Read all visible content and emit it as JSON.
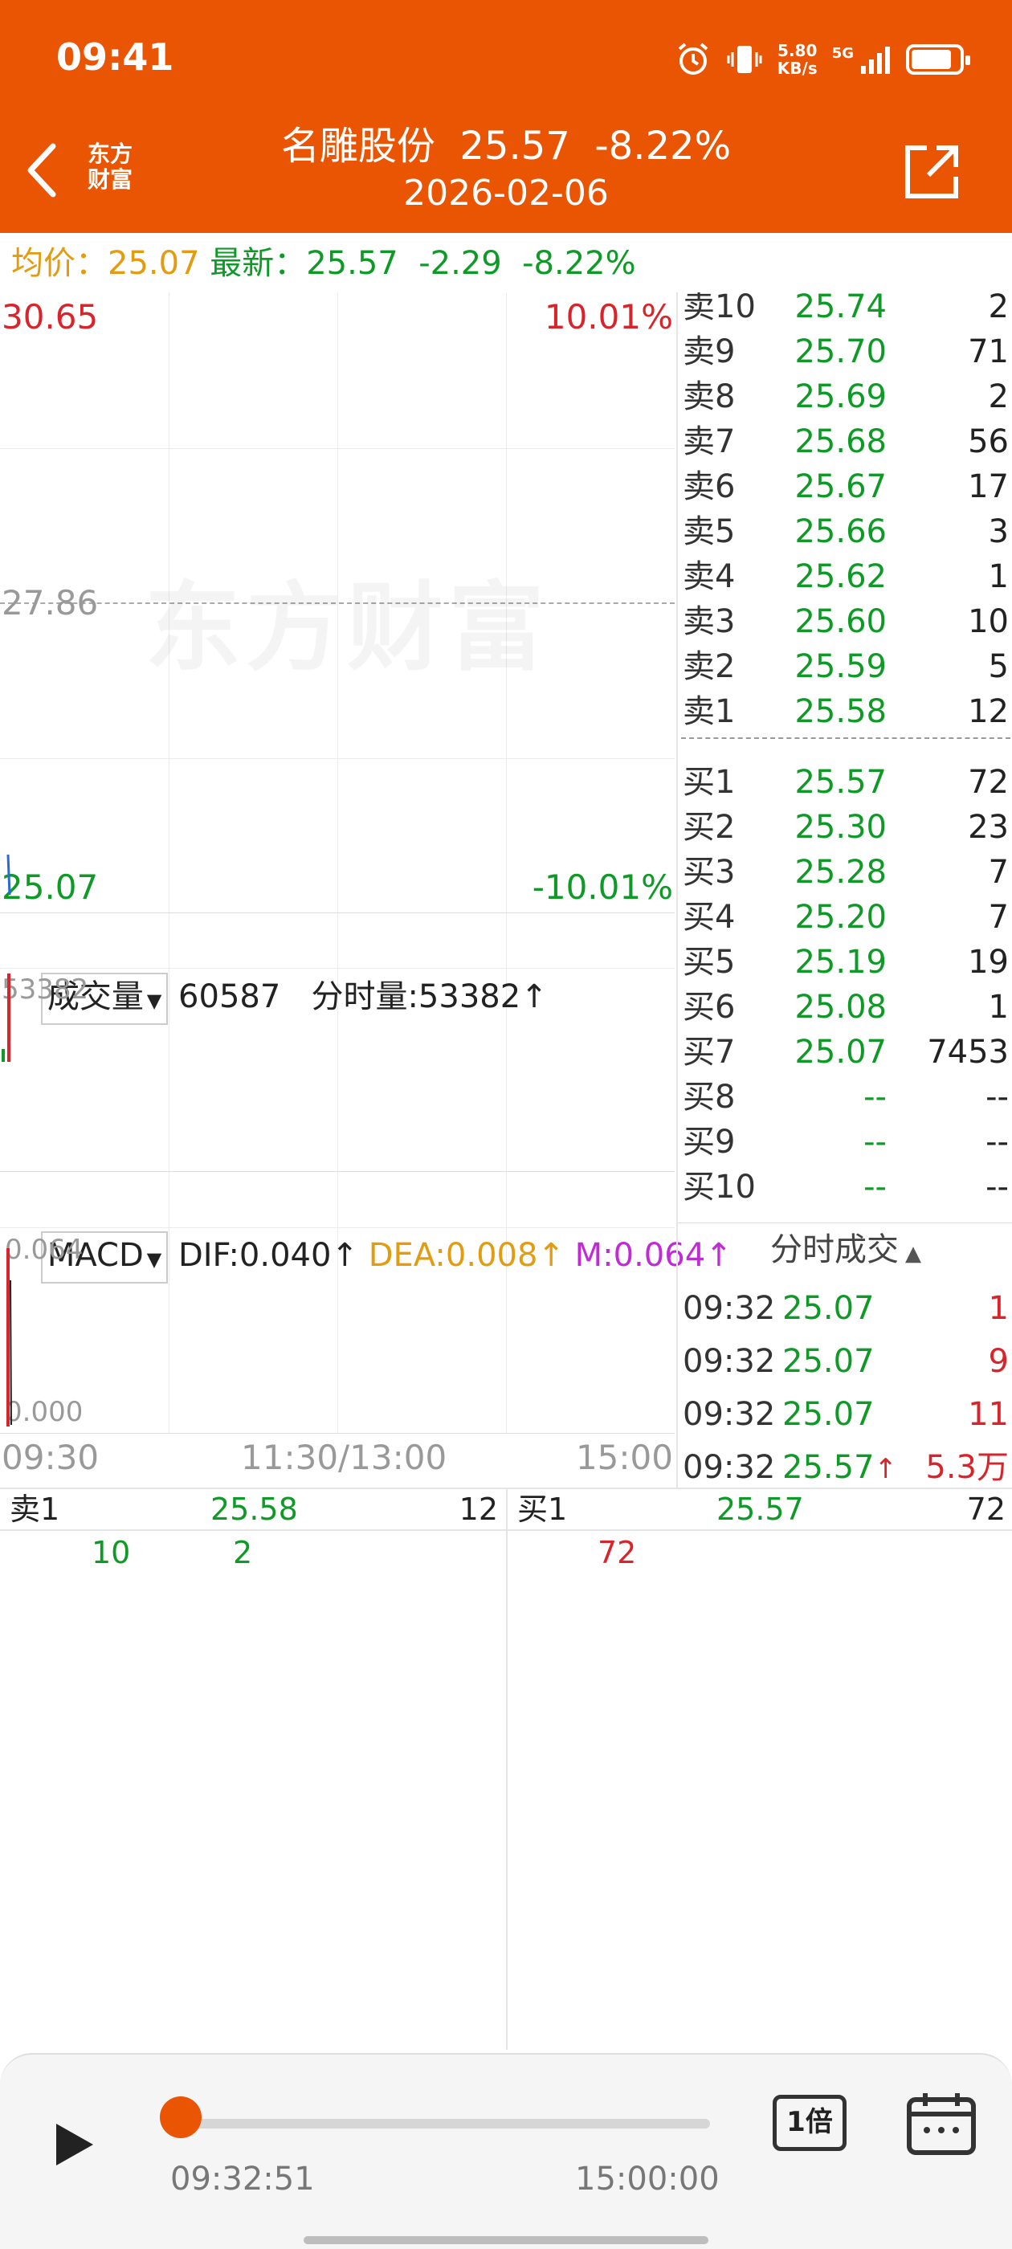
{
  "status_bar": {
    "time": "09:41",
    "net_speed_value": "5.80",
    "net_speed_unit": "KB/s",
    "network": "5G",
    "battery_level": 0.85
  },
  "header": {
    "logo_line1": "东方",
    "logo_line2": "财富",
    "stock_name": "名雕股份",
    "price": "25.57",
    "change_pct": "-8.22%",
    "date": "2026-02-06"
  },
  "info": {
    "avg_label": "均价：",
    "avg_value": "25.07",
    "latest_label": "最新：",
    "latest_value": "25.57",
    "change": "-2.29",
    "change_pct": "-8.22%"
  },
  "price_chart": {
    "high": "30.65",
    "high_pct": "10.01%",
    "mid": "27.86",
    "low": "25.07",
    "low_pct": "-10.01%",
    "watermark": "东方财富"
  },
  "volume_panel": {
    "selector": "成交量",
    "total": "60587",
    "minute_label": "分时量:53382",
    "axis_max": "53382"
  },
  "macd_panel": {
    "selector": "MACD",
    "dif": "DIF:0.040",
    "dea": "DEA:0.008",
    "m": "M:0.064",
    "axis_top": "0.064",
    "axis_bottom": "0.000"
  },
  "time_axis": {
    "start": "09:30",
    "middle": "11:30/13:00",
    "end": "15:00"
  },
  "order_book": {
    "asks": [
      {
        "name": "卖10",
        "price": "25.74",
        "vol": "2"
      },
      {
        "name": "卖9",
        "price": "25.70",
        "vol": "71"
      },
      {
        "name": "卖8",
        "price": "25.69",
        "vol": "2"
      },
      {
        "name": "卖7",
        "price": "25.68",
        "vol": "56"
      },
      {
        "name": "卖6",
        "price": "25.67",
        "vol": "17"
      },
      {
        "name": "卖5",
        "price": "25.66",
        "vol": "3"
      },
      {
        "name": "卖4",
        "price": "25.62",
        "vol": "1"
      },
      {
        "name": "卖3",
        "price": "25.60",
        "vol": "10"
      },
      {
        "name": "卖2",
        "price": "25.59",
        "vol": "5"
      },
      {
        "name": "卖1",
        "price": "25.58",
        "vol": "12"
      }
    ],
    "bids": [
      {
        "name": "买1",
        "price": "25.57",
        "vol": "72"
      },
      {
        "name": "买2",
        "price": "25.30",
        "vol": "23"
      },
      {
        "name": "买3",
        "price": "25.28",
        "vol": "7"
      },
      {
        "name": "买4",
        "price": "25.20",
        "vol": "7"
      },
      {
        "name": "买5",
        "price": "25.19",
        "vol": "19"
      },
      {
        "name": "买6",
        "price": "25.08",
        "vol": "1"
      },
      {
        "name": "买7",
        "price": "25.07",
        "vol": "7453"
      },
      {
        "name": "买8",
        "price": "--",
        "vol": "--"
      },
      {
        "name": "买9",
        "price": "--",
        "vol": "--"
      },
      {
        "name": "买10",
        "price": "--",
        "vol": "--"
      }
    ]
  },
  "ticks": {
    "title": "分时成交",
    "rows": [
      {
        "time": "09:32",
        "price": "25.07",
        "vol": "1"
      },
      {
        "time": "09:32",
        "price": "25.07",
        "vol": "9"
      },
      {
        "time": "09:32",
        "price": "25.07",
        "vol": "11"
      },
      {
        "time": "09:32",
        "price": "25.57",
        "vol": "5.3万"
      }
    ]
  },
  "bottom_bar": {
    "sell_label": "卖1",
    "sell_price": "25.58",
    "sell_vol": "12",
    "buy_label": "买1",
    "buy_price": "25.57",
    "buy_vol": "72",
    "sell_queue": [
      "10",
      "2"
    ],
    "buy_queue": [
      "72"
    ]
  },
  "playback": {
    "current_time": "09:32:51",
    "end_time": "15:00:00",
    "speed": "1倍",
    "progress": 0.01
  }
}
